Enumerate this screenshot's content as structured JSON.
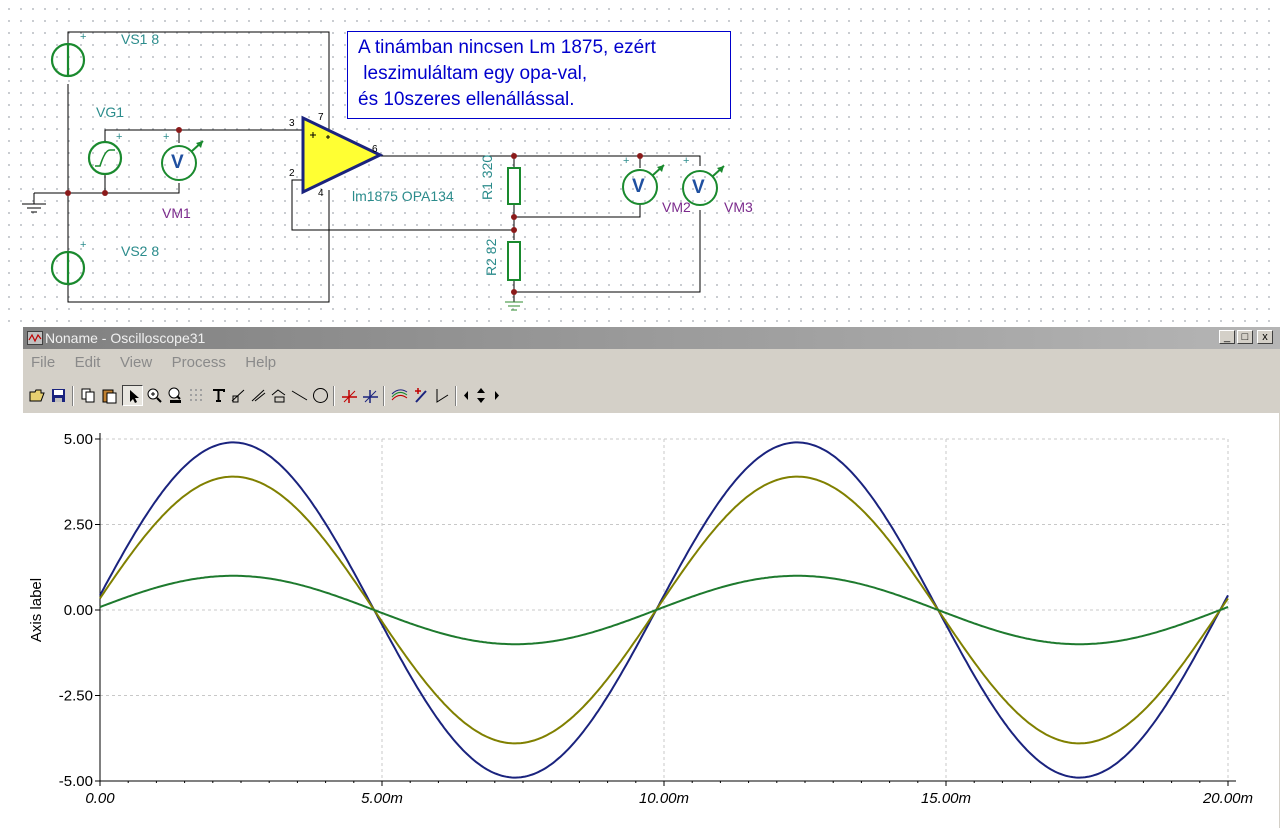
{
  "schematic": {
    "note_lines": [
      "A tinámban nincsen Lm 1875, ezért",
      " leszimuláltam egy opa-val,",
      "és 10szeres ellenállással."
    ],
    "components": {
      "vs1": "VS1 8",
      "vs2": "VS2 8",
      "vg1": "VG1",
      "vm1": "VM1",
      "vm2": "VM2",
      "vm3": "VM3",
      "opamp": "lm1875 OPA134",
      "r1": "R1 320",
      "r2": "R2 82",
      "pin3": "3",
      "pin2": "2",
      "pin6": "6",
      "pin7": "7",
      "pin4": "4",
      "meter_symbol": "V"
    }
  },
  "oscilloscope": {
    "title": "Noname - Oscilloscope31",
    "window_buttons": [
      "_",
      "□",
      "x"
    ],
    "menu": [
      "File",
      "Edit",
      "View",
      "Process",
      "Help"
    ],
    "toolbar": [
      "open-icon",
      "save-icon",
      "copy-icon",
      "paste-icon",
      "pointer-icon",
      "zoom-in-icon",
      "zoom-100-icon",
      "grid-icon",
      "text-icon",
      "line-tool-icon",
      "line-tool-2-icon",
      "line-tool-3-icon",
      "line-icon",
      "circle-icon",
      "cursor-a-icon",
      "cursor-b-icon",
      "trace-select-icon",
      "marker-icon",
      "arrow-icon",
      "scroll-left-icon",
      "scroll-updown-icon",
      "scroll-right-icon"
    ]
  },
  "chart_data": {
    "type": "line",
    "ylabel": "Axis label",
    "xlabel": "",
    "xlim": [
      0,
      0.02
    ],
    "ylim": [
      -5,
      5
    ],
    "x_ticks": [
      "0.00",
      "5.00m",
      "10.00m",
      "15.00m",
      "20.00m"
    ],
    "y_ticks": [
      "5.00",
      "2.50",
      "0.00",
      "-2.50",
      "-5.00"
    ],
    "grid": true,
    "frequency_hz": 100,
    "series": [
      {
        "amplitude": 4.9,
        "phase_deg": 5,
        "color": "#1a237e"
      },
      {
        "amplitude": 3.9,
        "phase_deg": 5,
        "color": "#808000"
      },
      {
        "amplitude": 1.0,
        "phase_deg": 5,
        "color": "#1e7a2e"
      }
    ]
  }
}
